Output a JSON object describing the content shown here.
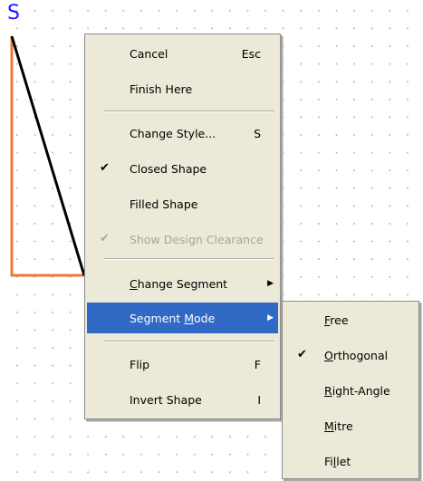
{
  "canvas": {
    "start_marker": "S",
    "colors": {
      "outline": "#e8783a",
      "segment": "#000000",
      "marker": "#1a1aff",
      "grid_dot": "#b8b8b8"
    }
  },
  "context_menu": {
    "items": [
      {
        "label": "Cancel",
        "shortcut": "Esc"
      },
      {
        "label": "Finish Here"
      },
      {
        "label": "Change Style...",
        "shortcut": "S"
      },
      {
        "label": "Closed Shape",
        "checked": true
      },
      {
        "label": "Filled Shape"
      },
      {
        "label": "Show Design Clearance",
        "checked": true,
        "disabled": true
      },
      {
        "label_pre": "",
        "mnemonic": "C",
        "label_post": "hange Segment",
        "has_submenu": true
      },
      {
        "label_pre": "Segment ",
        "mnemonic": "M",
        "label_post": "ode",
        "has_submenu": true,
        "highlighted": true
      },
      {
        "label": "Flip",
        "shortcut": "F"
      },
      {
        "label": "Invert Shape",
        "shortcut": "I"
      }
    ],
    "colors": {
      "background": "#ece9d8",
      "highlight": "#316ac5",
      "disabled_text": "#a8a69b"
    }
  },
  "segment_mode_submenu": {
    "items": [
      {
        "label_pre": "",
        "mnemonic": "F",
        "label_post": "ree"
      },
      {
        "label_pre": "",
        "mnemonic": "O",
        "label_post": "rthogonal",
        "checked": true
      },
      {
        "label_pre": "",
        "mnemonic": "R",
        "label_post": "ight-Angle"
      },
      {
        "label_pre": "",
        "mnemonic": "M",
        "label_post": "itre"
      },
      {
        "label_pre": "Fi",
        "mnemonic": "l",
        "label_post": "let"
      }
    ]
  },
  "glyphs": {
    "check": "✔",
    "submenu_arrow": "▶"
  }
}
